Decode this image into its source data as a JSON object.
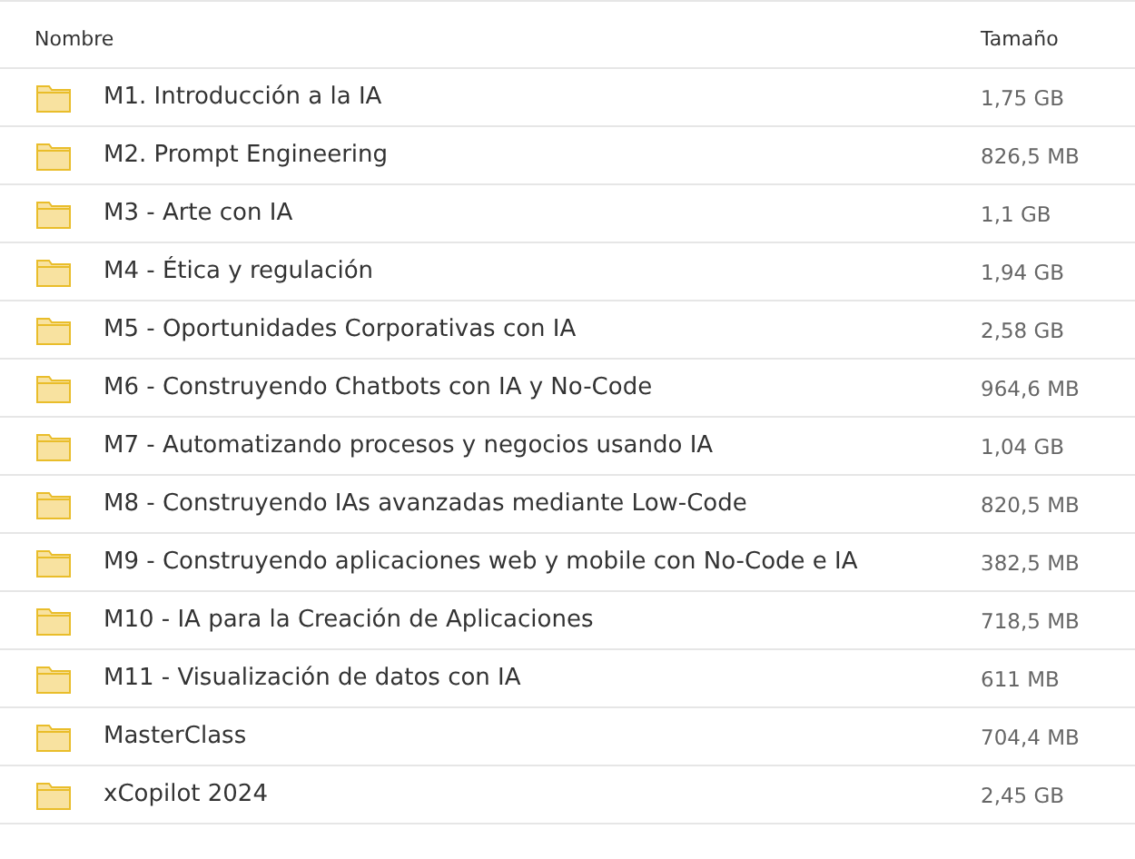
{
  "table": {
    "columns": [
      "Nombre",
      "Tamaño"
    ],
    "rows": [
      {
        "name": "M1. Introducción a la IA",
        "size": "1,75 GB"
      },
      {
        "name": "M2. Prompt Engineering",
        "size": "826,5 MB"
      },
      {
        "name": "M3 - Arte con IA",
        "size": "1,1 GB"
      },
      {
        "name": "M4 - Ética y regulación",
        "size": "1,94 GB"
      },
      {
        "name": "M5 - Oportunidades Corporativas con IA",
        "size": "2,58 GB"
      },
      {
        "name": "M6 - Construyendo Chatbots con IA y No-Code",
        "size": "964,6 MB"
      },
      {
        "name": "M7 - Automatizando procesos y negocios usando IA",
        "size": "1,04 GB"
      },
      {
        "name": "M8 - Construyendo IAs avanzadas mediante Low-Code",
        "size": "820,5 MB"
      },
      {
        "name": "M9 - Construyendo aplicaciones web y mobile con No-Code e IA",
        "size": "382,5 MB"
      },
      {
        "name": "M10 - IA para la Creación de Aplicaciones",
        "size": "718,5 MB"
      },
      {
        "name": "M11 - Visualización de datos con IA",
        "size": "611 MB"
      },
      {
        "name": "MasterClass",
        "size": "704,4 MB"
      },
      {
        "name": "xCopilot 2024",
        "size": "2,45 GB"
      }
    ]
  }
}
